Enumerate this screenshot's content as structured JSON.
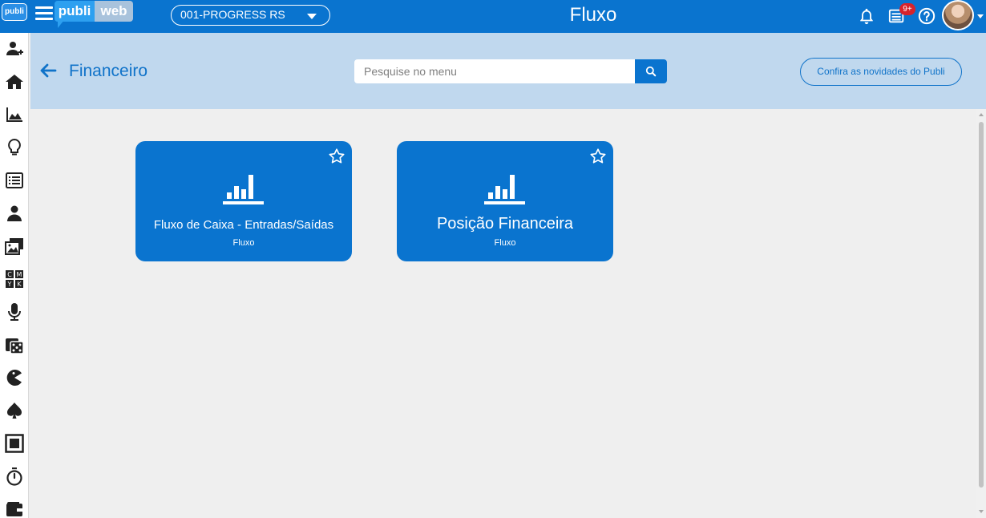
{
  "topbar": {
    "logo_text": "publi",
    "brand_publi": "publi",
    "brand_web": "web",
    "company": "001-PROGRESS RS",
    "title": "Fluxo",
    "notification_badge": "9+",
    "icons": [
      "bell-icon",
      "news-icon",
      "help-icon",
      "user-avatar"
    ]
  },
  "sidebar": {
    "items": [
      {
        "icon": "user-add-icon"
      },
      {
        "icon": "home-icon"
      },
      {
        "icon": "area-chart-icon"
      },
      {
        "icon": "lightbulb-icon"
      },
      {
        "icon": "list-icon"
      },
      {
        "icon": "user-icon"
      },
      {
        "icon": "images-icon"
      },
      {
        "icon": "cmyk-icon"
      },
      {
        "icon": "microphone-icon"
      },
      {
        "icon": "dice-icon"
      },
      {
        "icon": "pacman-icon"
      },
      {
        "icon": "spade-icon"
      },
      {
        "icon": "stop-icon"
      },
      {
        "icon": "stopwatch-icon"
      },
      {
        "icon": "wallet-icon"
      }
    ]
  },
  "subheader": {
    "section_title": "Financeiro",
    "search_placeholder": "Pesquise no menu",
    "news_button": "Confira as novidades do Publi"
  },
  "cards": [
    {
      "title": "Fluxo de Caixa - Entradas/Saídas",
      "subtitle": "Fluxo",
      "icon": "bar-chart-icon"
    },
    {
      "title": "Posição Financeira",
      "subtitle": "Fluxo",
      "icon": "bar-chart-icon"
    }
  ],
  "colors": {
    "primary": "#0a74cf",
    "subheader_bg": "#c0d8ee",
    "page_bg": "#efefef",
    "badge": "#d6232b"
  }
}
